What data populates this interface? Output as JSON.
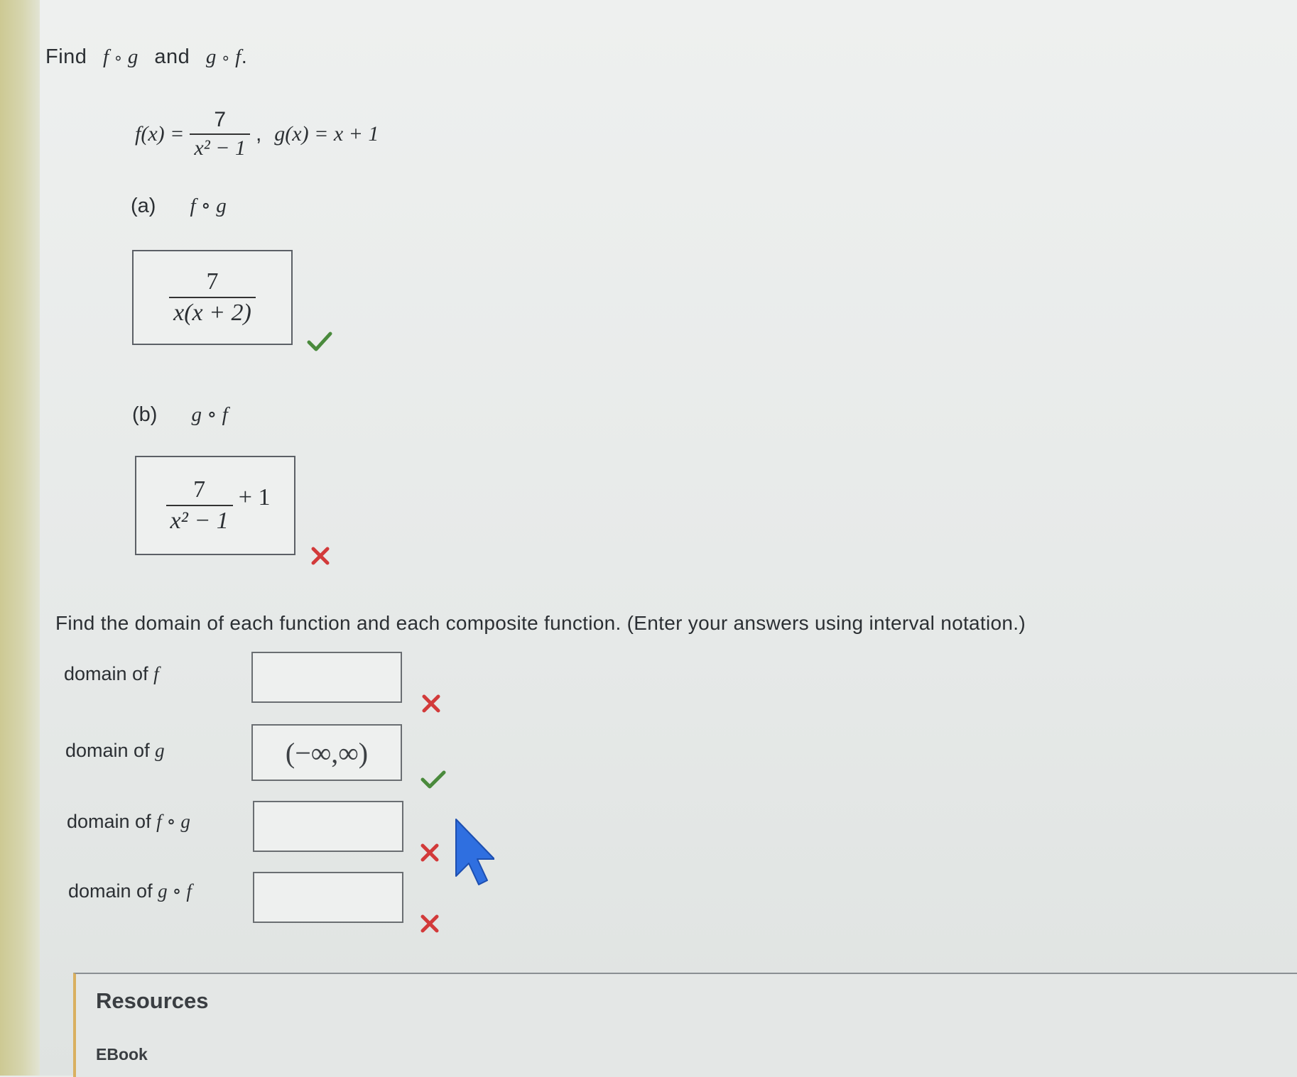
{
  "question": {
    "find_word": "Find",
    "f": "f",
    "g": "g",
    "circ": "∘",
    "and_word": "and",
    "period": "."
  },
  "given": {
    "f_lhs": "f(x) =",
    "f_num": "7",
    "f_den": "x² − 1",
    "comma": ",",
    "g_def": "g(x) = x + 1"
  },
  "part_a": {
    "label": "(a)",
    "fn": "f ∘ g",
    "answer_num": "7",
    "answer_den": "x(x + 2)",
    "status": "correct"
  },
  "part_b": {
    "label": "(b)",
    "fn": "g ∘ f",
    "answer_num": "7",
    "answer_den": "x² − 1",
    "answer_tail": "+ 1",
    "status": "incorrect"
  },
  "domain_prompt": "Find the domain of each function and each composite function. (Enter your answers using interval notation.)",
  "domains": [
    {
      "label": "domain of",
      "fn": "f",
      "value": "",
      "status": "incorrect"
    },
    {
      "label": "domain of",
      "fn": "g",
      "value": "(−∞,∞)",
      "status": "correct"
    },
    {
      "label": "domain of",
      "fn": "f ∘ g",
      "value": "",
      "status": "incorrect"
    },
    {
      "label": "domain of",
      "fn": "g ∘ f",
      "value": "",
      "status": "incorrect"
    }
  ],
  "resources": {
    "title": "Resources",
    "ebook": "EBook"
  },
  "colors": {
    "correct": "#4a8a3c",
    "incorrect": "#d23a3a",
    "cursor": "#2f6fe0",
    "resources_accent": "#d9b060"
  }
}
